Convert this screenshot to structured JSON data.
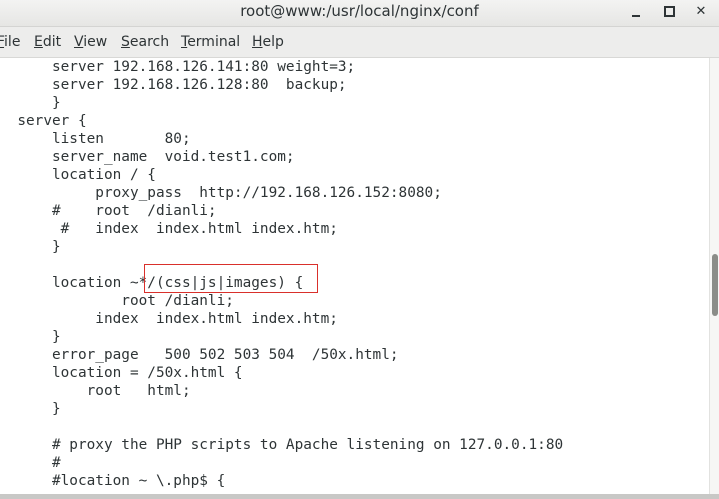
{
  "window": {
    "title": "root@www:/usr/local/nginx/conf"
  },
  "menubar": {
    "items": [
      {
        "accel": "F",
        "rest": "ile"
      },
      {
        "accel": "E",
        "rest": "dit"
      },
      {
        "accel": "V",
        "rest": "iew"
      },
      {
        "accel": "S",
        "rest": "earch"
      },
      {
        "accel": "T",
        "rest": "erminal"
      },
      {
        "accel": "H",
        "rest": "elp"
      }
    ]
  },
  "terminal": {
    "lines": [
      "      server 192.168.126.141:80 weight=3;",
      "      server 192.168.126.128:80  backup;",
      "      }",
      "  server {",
      "      listen       80;",
      "      server_name  void.test1.com;",
      "      location / {",
      "           proxy_pass  http://192.168.126.152:8080;",
      "      #    root  /dianli;",
      "       #   index  index.html index.htm;",
      "      }",
      "",
      "      location ~*/(css|js|images) {",
      "              root /dianli;",
      "           index  index.html index.htm;",
      "      }",
      "      error_page   500 502 503 504  /50x.html;",
      "      location = /50x.html {",
      "          root   html;",
      "      }",
      "",
      "      # proxy the PHP scripts to Apache listening on 127.0.0.1:80",
      "      #",
      "      #location ~ \\.php$ {"
    ],
    "highlight_color": "#d9302b"
  }
}
